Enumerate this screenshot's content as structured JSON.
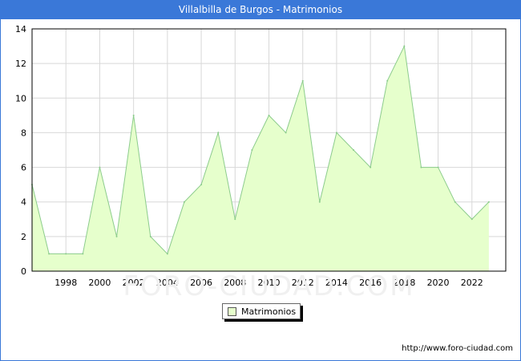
{
  "title": "Villalbilla de Burgos - Matrimonios",
  "source": "http://www.foro-ciudad.com",
  "watermark": "FORO-CIUDAD.COM",
  "colors": {
    "header": "#3a78d8",
    "area_fill": "#e6ffcc",
    "line": "#8ccc8c",
    "grid": "#d8d8d8"
  },
  "chart_data": {
    "type": "area",
    "title": "Villalbilla de Burgos - Matrimonios",
    "xlabel": "",
    "ylabel": "",
    "x": [
      1996,
      1997,
      1998,
      1999,
      2000,
      2001,
      2002,
      2003,
      2004,
      2005,
      2006,
      2007,
      2008,
      2009,
      2010,
      2011,
      2012,
      2013,
      2014,
      2015,
      2016,
      2017,
      2018,
      2019,
      2020,
      2021,
      2022,
      2023
    ],
    "series": [
      {
        "name": "Matrimonios",
        "values": [
          5,
          1,
          1,
          1,
          6,
          2,
          9,
          2,
          1,
          4,
          5,
          8,
          3,
          7,
          9,
          8,
          11,
          4,
          8,
          7,
          6,
          11,
          13,
          6,
          6,
          4,
          3,
          4
        ]
      }
    ],
    "xticks": [
      "1998",
      "2000",
      "2002",
      "2004",
      "2006",
      "2008",
      "2010",
      "2012",
      "2014",
      "2016",
      "2018",
      "2020",
      "2022"
    ],
    "yticks": [
      "0",
      "2",
      "4",
      "6",
      "8",
      "10",
      "12",
      "14"
    ],
    "ylim": [
      0,
      14
    ],
    "grid": true,
    "legend": "bottom-center"
  }
}
